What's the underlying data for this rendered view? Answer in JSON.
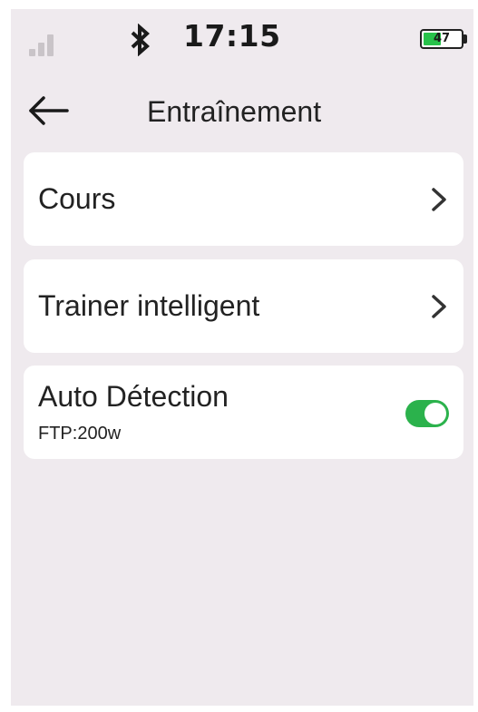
{
  "status_bar": {
    "time": "17:15",
    "battery_level": "47",
    "battery_fraction": 0.47,
    "signal_icon": "signal-bars-icon",
    "bluetooth_icon": "bluetooth-icon"
  },
  "header": {
    "back_icon": "back-arrow-icon",
    "title": "Entraînement"
  },
  "menu": {
    "items": [
      {
        "label": "Cours",
        "icon": "chevron-right-icon"
      },
      {
        "label": "Trainer intelligent",
        "icon": "chevron-right-icon"
      }
    ],
    "auto_detection": {
      "label": "Auto Détection",
      "sublabel": "FTP:200w",
      "enabled": true
    }
  },
  "colors": {
    "background": "#efeaee",
    "card": "#ffffff",
    "toggle_on": "#2bb24c",
    "battery_fill": "#27c24a"
  }
}
